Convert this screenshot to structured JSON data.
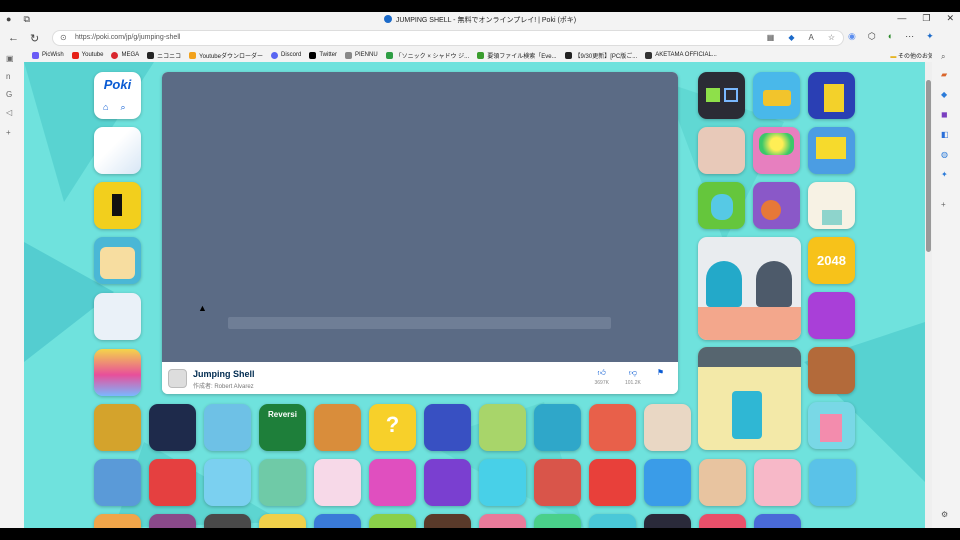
{
  "browser": {
    "tab_title": "JUMPING SHELL - 無料でオンラインプレイ! | Poki (ポキ)",
    "url": "https://poki.com/jp/g/jumping-shell",
    "window_controls": [
      "—",
      "❐",
      "✕"
    ],
    "bookmarks": [
      {
        "label": "PicWish",
        "color": "#6b5cf6"
      },
      {
        "label": "Youtube",
        "color": "#e62117"
      },
      {
        "label": "MEGA",
        "color": "#d9272e"
      },
      {
        "label": "ニコニコ",
        "color": "#252525"
      },
      {
        "label": "Youtubeダウンローダー",
        "color": "#f2a21c"
      },
      {
        "label": "Discord",
        "color": "#5865f2"
      },
      {
        "label": "Twitter",
        "color": "#000000"
      },
      {
        "label": "PIENNU",
        "color": "#888888"
      },
      {
        "label": "「ソニック × シャドウ ジ...",
        "color": "#2e9e44"
      },
      {
        "label": "要領ファイル検索「Eve...",
        "color": "#3a9d2e"
      },
      {
        "label": "【9/30更新】[PC版ご...",
        "color": "#222222"
      },
      {
        "label": "AKETAMA OFFICIAL...",
        "color": "#333333"
      }
    ],
    "other_bookmarks": "その他のお気に入り"
  },
  "poki": {
    "logo": "Poki",
    "game": {
      "title": "Jumping Shell",
      "author": "作成者: Robert Alvarez",
      "likes": "3697K",
      "dislikes": "101.2K"
    },
    "colors": {
      "background": "#6fe2dd",
      "game_area": "#5b6b85",
      "brand": "#0a5bd3"
    }
  }
}
